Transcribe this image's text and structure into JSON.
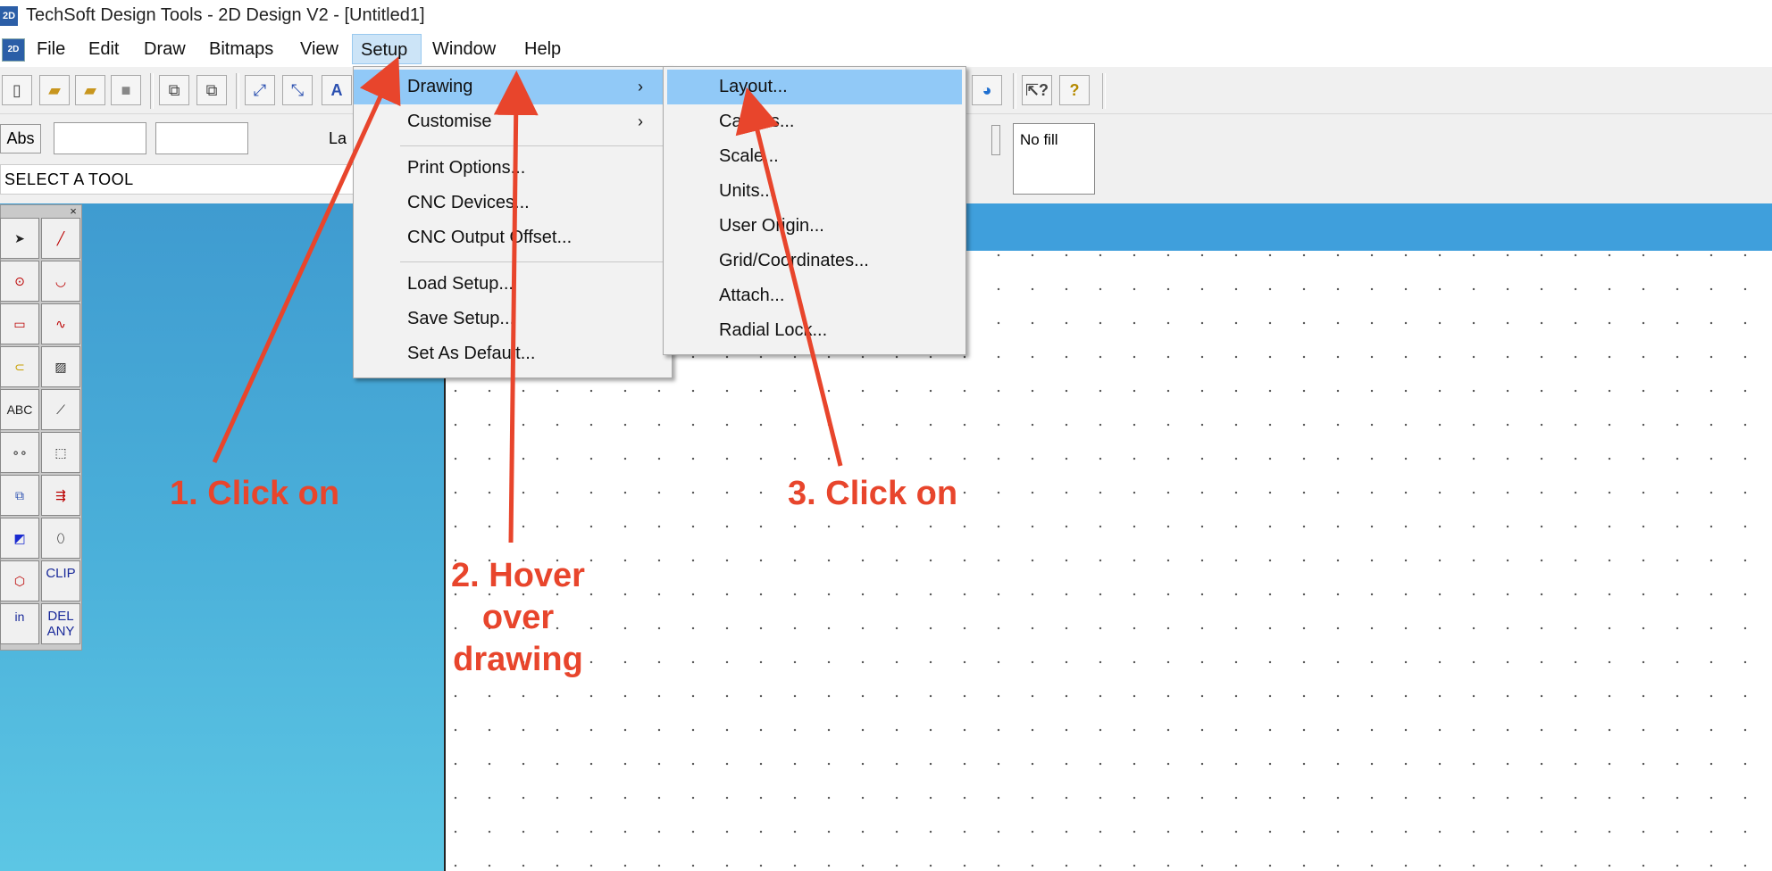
{
  "window": {
    "title": "TechSoft Design Tools - 2D Design V2 - [Untitled1]",
    "app_icon": "2D"
  },
  "menubar": {
    "items": [
      "File",
      "Edit",
      "Draw",
      "Bitmaps",
      "View",
      "Setup",
      "Window",
      "Help"
    ],
    "active": "Setup"
  },
  "property_bar": {
    "abs_label": "Abs",
    "layer_label_partial": "La",
    "fill_label": "No fill"
  },
  "status": {
    "text": "SELECT A TOOL"
  },
  "palette": {
    "text_tools": {
      "abc": "ABC",
      "clip": "CLIP",
      "del": "DEL",
      "any": "ANY",
      "in": "in"
    }
  },
  "setup_menu": {
    "items": [
      {
        "label": "Drawing",
        "submenu": true,
        "highlighted": true
      },
      {
        "label": "Customise",
        "submenu": true
      },
      {
        "separator": true
      },
      {
        "label": "Print Options..."
      },
      {
        "label": "CNC Devices..."
      },
      {
        "label": "CNC Output Offset..."
      },
      {
        "separator": true
      },
      {
        "label": "Load Setup..."
      },
      {
        "label": "Save Setup..."
      },
      {
        "label": "Set As Default..."
      }
    ]
  },
  "drawing_submenu": {
    "items": [
      {
        "label": "Layout...",
        "highlighted": true
      },
      {
        "label": "Canvas..."
      },
      {
        "label": "Scale..."
      },
      {
        "label": "Units..."
      },
      {
        "label": "User Origin..."
      },
      {
        "label": "Grid/Coordinates..."
      },
      {
        "label": "Attach..."
      },
      {
        "label": "Radial Lock..."
      }
    ]
  },
  "annotations": {
    "step1": "1. Click on",
    "step2_line1": "2. Hover",
    "step2_line2": "over",
    "step2_line3": "drawing",
    "step3": "3. Click on",
    "color": "#e8452c"
  }
}
